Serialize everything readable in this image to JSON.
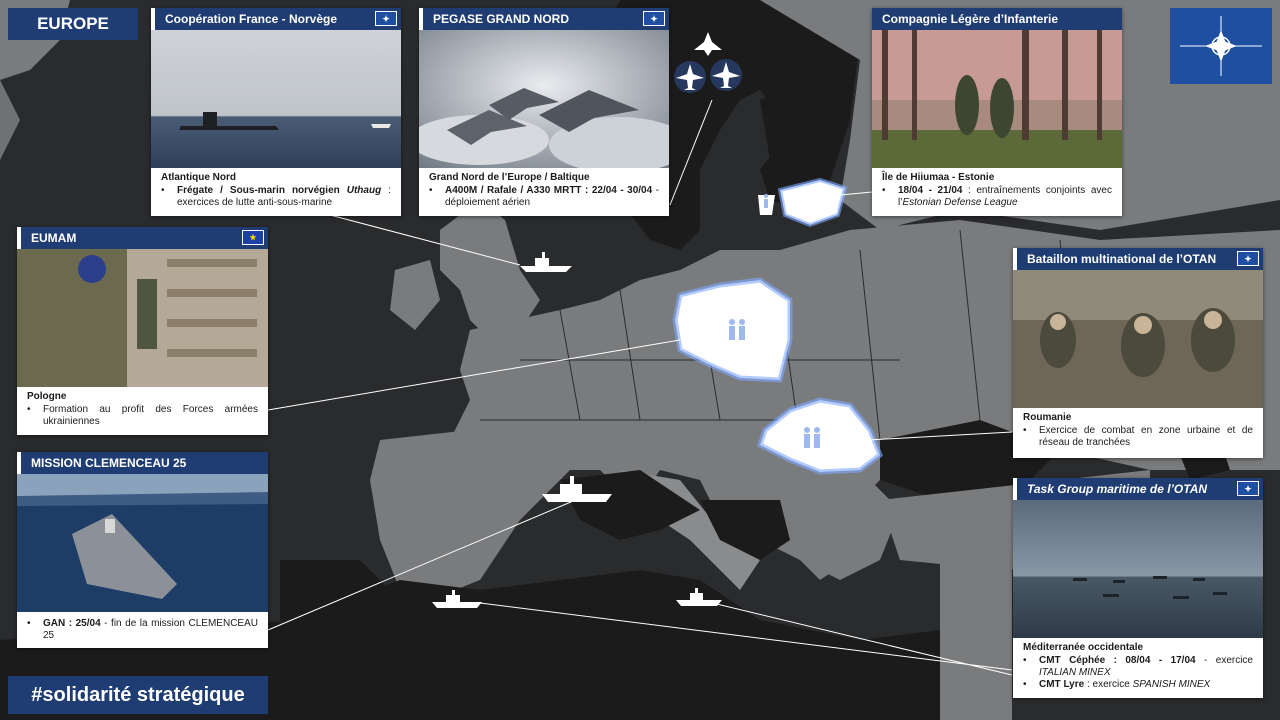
{
  "header": {
    "title": "EUROPE"
  },
  "footer": {
    "hashtag": "#solidarité stratégique"
  },
  "colors": {
    "navy": "#1f3d73",
    "map_land": "#7a7b7d",
    "map_dark": "#1b1b1c",
    "sea": "#2a2b2d",
    "highlight": "#ffffff",
    "glow": "#7fa8ff"
  },
  "cards": {
    "france_norvege": {
      "title": "Coopération France - Norvège",
      "flag": "nato-flag",
      "place": "Atlantique Nord",
      "text_bold": "Frégate / Sous-marin norvégien ",
      "text_italic": "Uthaug",
      "text_rest": " : exercices de lutte anti-sous-marine"
    },
    "pegase": {
      "title": "PEGASE GRAND NORD",
      "flag": "nato-flag",
      "place": "Grand Nord de l’Europe / Baltique",
      "text_bold": "A400M / Rafale / A330 MRTT : 22/04 - 30/04",
      "text_rest": " - déploiement aérien"
    },
    "compagnie": {
      "title": "Compagnie Légère d’Infanterie",
      "flag": "nato-flag",
      "place": "Île de Hiiumaa - Estonie",
      "text_bold": "18/04 - 21/04",
      "text_rest": " : entraînements conjoints avec l’",
      "text_italic": "Estonian Defense League"
    },
    "eumam": {
      "title": "EUMAM",
      "flag": "eu-flag",
      "place": "Pologne",
      "text_rest": "Formation au profit des Forces armées ukrainiennes"
    },
    "bataillon": {
      "title": "Bataillon multinational de l’OTAN",
      "flag": "nato-flag",
      "place": "Roumanie",
      "text_rest": "Exercice de combat en zone urbaine et de réseau de tranchées"
    },
    "clemenceau": {
      "title": "MISSION CLEMENCEAU 25",
      "text_bold": "GAN : 25/04",
      "text_rest": " - fin de la mission CLEMENCEAU 25"
    },
    "taskgroup": {
      "title": "Task Group maritime de l’OTAN",
      "flag": "nato-flag",
      "place": "Méditerranée occidentale",
      "item1_bold": "CMT Céphée : 08/04 - 17/04",
      "item1_rest": " - exercice ",
      "item1_italic": "ITALIAN MINEX",
      "item2_bold": "CMT Lyre",
      "item2_rest": " : exercice ",
      "item2_italic": "SPANISH MINEX"
    }
  },
  "icons": [
    "ship-icon",
    "plane-icon",
    "fighter-jet-icon",
    "soldiers-icon",
    "nato-compass-icon"
  ]
}
